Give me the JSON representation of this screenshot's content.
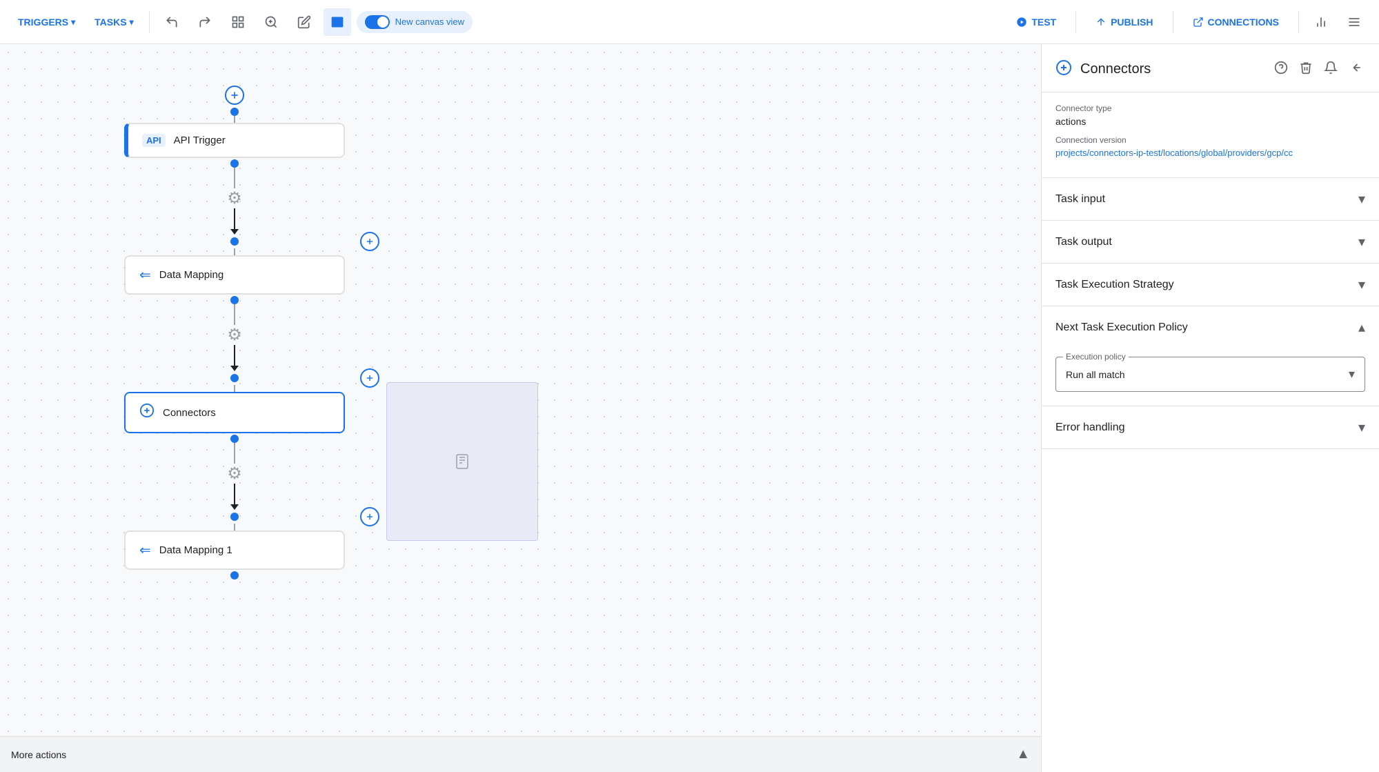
{
  "toolbar": {
    "triggers_label": "TRIGGERS",
    "tasks_label": "TASKS",
    "toggle_label": "New canvas view",
    "test_label": "TEST",
    "publish_label": "PUBLISH",
    "connections_label": "CONNECTIONS"
  },
  "canvas": {
    "nodes": [
      {
        "id": "api-trigger",
        "label": "API Trigger",
        "type": "api-trigger",
        "icon": "API"
      },
      {
        "id": "data-mapping",
        "label": "Data Mapping",
        "type": "data-mapping",
        "icon": "↔"
      },
      {
        "id": "connectors",
        "label": "Connectors",
        "type": "connectors",
        "icon": "⟳"
      },
      {
        "id": "data-mapping-1",
        "label": "Data Mapping 1",
        "type": "data-mapping",
        "icon": "↔"
      }
    ],
    "more_actions_label": "More actions"
  },
  "right_panel": {
    "title": "Connectors",
    "info": {
      "connector_type_label": "Connector type",
      "connector_type_value": "actions",
      "connection_version_label": "Connection version",
      "connection_version_value": "projects/connectors-ip-test/locations/global/providers/gcp/cc"
    },
    "sections": [
      {
        "id": "task-input",
        "label": "Task input",
        "expanded": false
      },
      {
        "id": "task-output",
        "label": "Task output",
        "expanded": false
      },
      {
        "id": "task-execution-strategy",
        "label": "Task Execution Strategy",
        "expanded": false
      },
      {
        "id": "next-task-execution-policy",
        "label": "Next Task Execution Policy",
        "expanded": true
      },
      {
        "id": "error-handling",
        "label": "Error handling",
        "expanded": false
      }
    ],
    "execution_policy": {
      "label": "Execution policy",
      "value": "Run all match"
    }
  }
}
